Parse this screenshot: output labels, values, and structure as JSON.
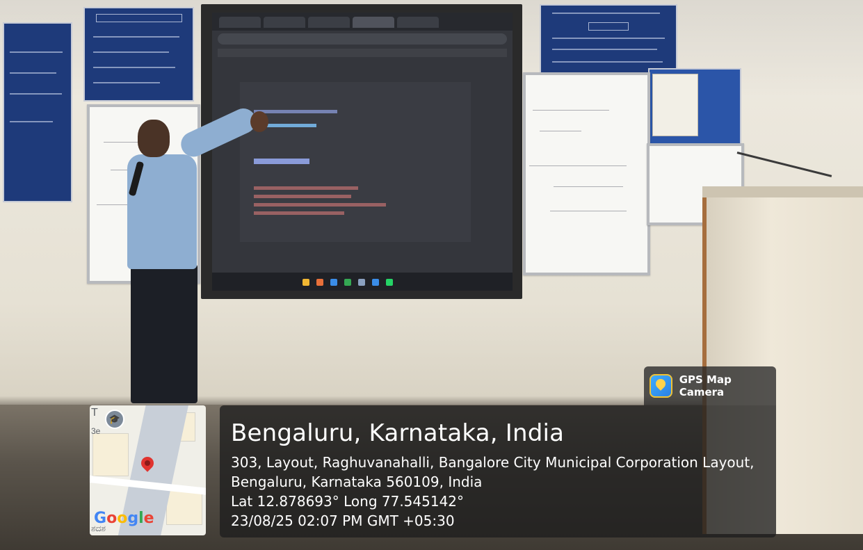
{
  "gps_overlay": {
    "app_name": "GPS Map Camera",
    "location_title": "Bengaluru, Karnataka, India",
    "address_line_1": "303, Layout, Raghuvanahalli, Bangalore City Municipal Corporation Layout,",
    "address_line_2": "Bengaluru, Karnataka 560109, India",
    "coordinates": "Lat 12.878693° Long 77.545142°",
    "timestamp": "23/08/25 02:07 PM GMT +05:30"
  },
  "map": {
    "brand": "Google",
    "label_top": "T",
    "label_left": "3e",
    "label_bottom": "ಶದಶ"
  },
  "colors": {
    "overlay_bg": "#1e1e1e",
    "pin": "#e0332f",
    "notice_board": "#1e3a7a"
  }
}
